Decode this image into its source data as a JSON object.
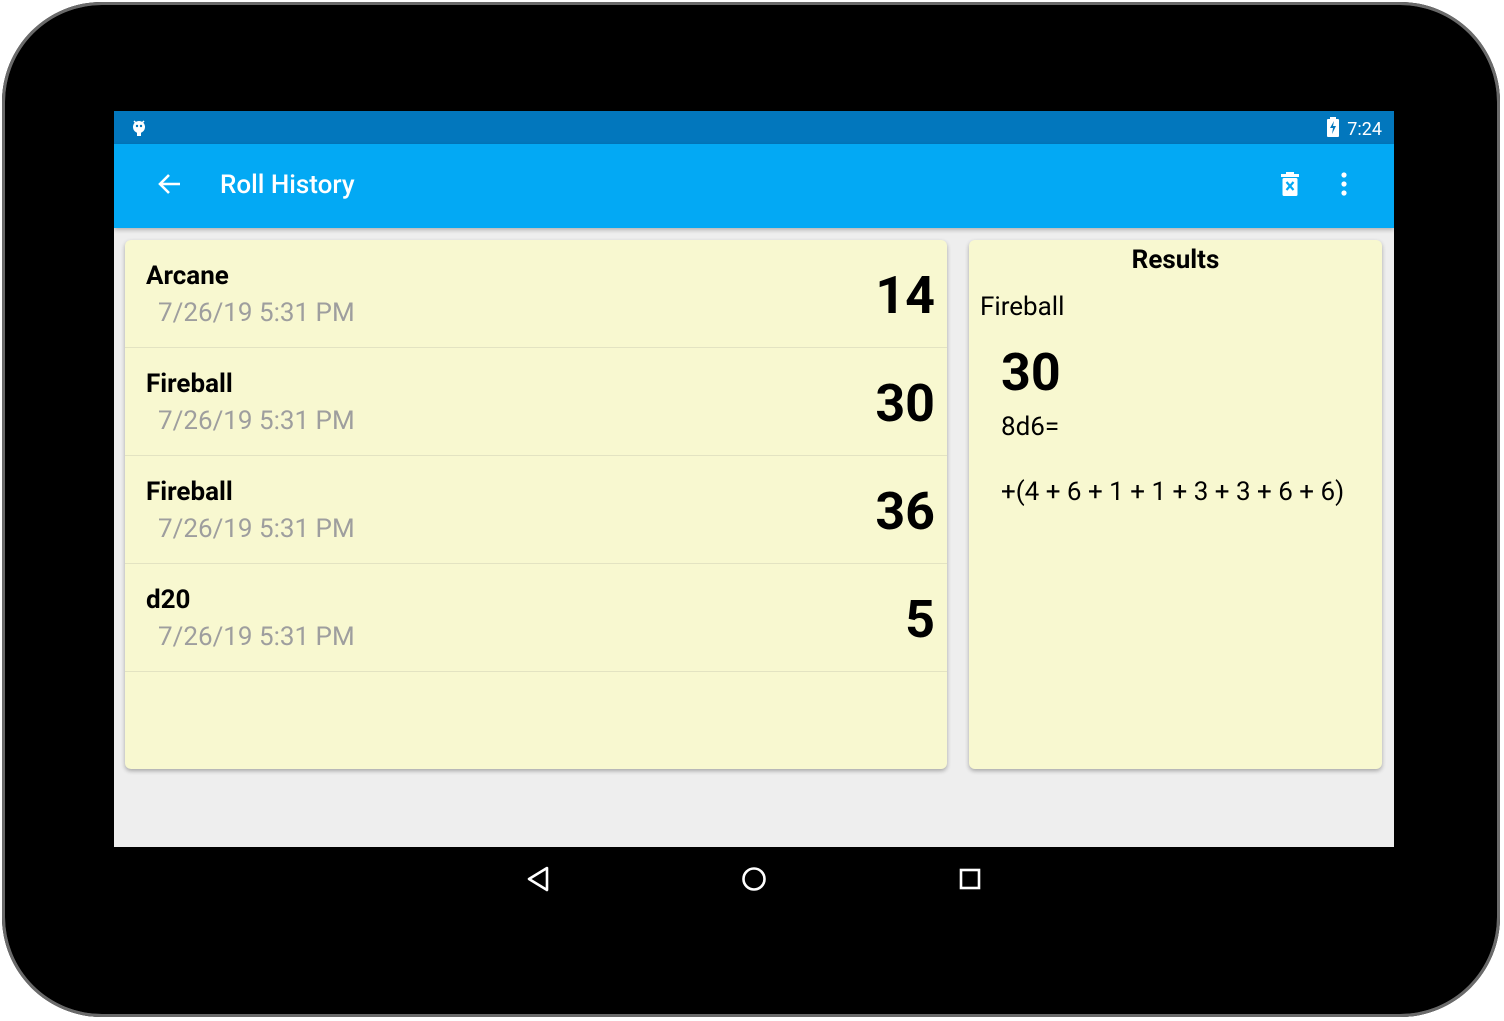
{
  "status_bar": {
    "time": "7:24",
    "left_icon": "android-debug-icon",
    "battery_icon": "battery-charging-icon"
  },
  "app_bar": {
    "title": "Roll History",
    "back_icon": "arrow-back-icon",
    "delete_icon": "delete-sweep-icon",
    "overflow_icon": "more-vert-icon"
  },
  "history": {
    "rows": [
      {
        "name": "Arcane",
        "time": "7/26/19 5:31 PM",
        "total": "14"
      },
      {
        "name": "Fireball",
        "time": "7/26/19 5:31 PM",
        "total": "30"
      },
      {
        "name": "Fireball",
        "time": "7/26/19 5:31 PM",
        "total": "36"
      },
      {
        "name": "d20",
        "time": "7/26/19 5:31 PM",
        "total": "5"
      }
    ]
  },
  "results": {
    "title": "Results",
    "name": "Fireball",
    "total": "30",
    "expression": "8d6=",
    "detail": "+(4 + 6 + 1 + 1 + 3 + 3 + 6 + 6)"
  },
  "nav_bar": {
    "back_icon": "nav-back-icon",
    "home_icon": "nav-home-icon",
    "recents_icon": "nav-recents-icon"
  },
  "colors": {
    "status_bar": "#0277bd",
    "app_bar": "#03a9f4",
    "card": "#f8f8d0",
    "timestamp": "#9e9e9e",
    "background": "#eeeeee"
  }
}
